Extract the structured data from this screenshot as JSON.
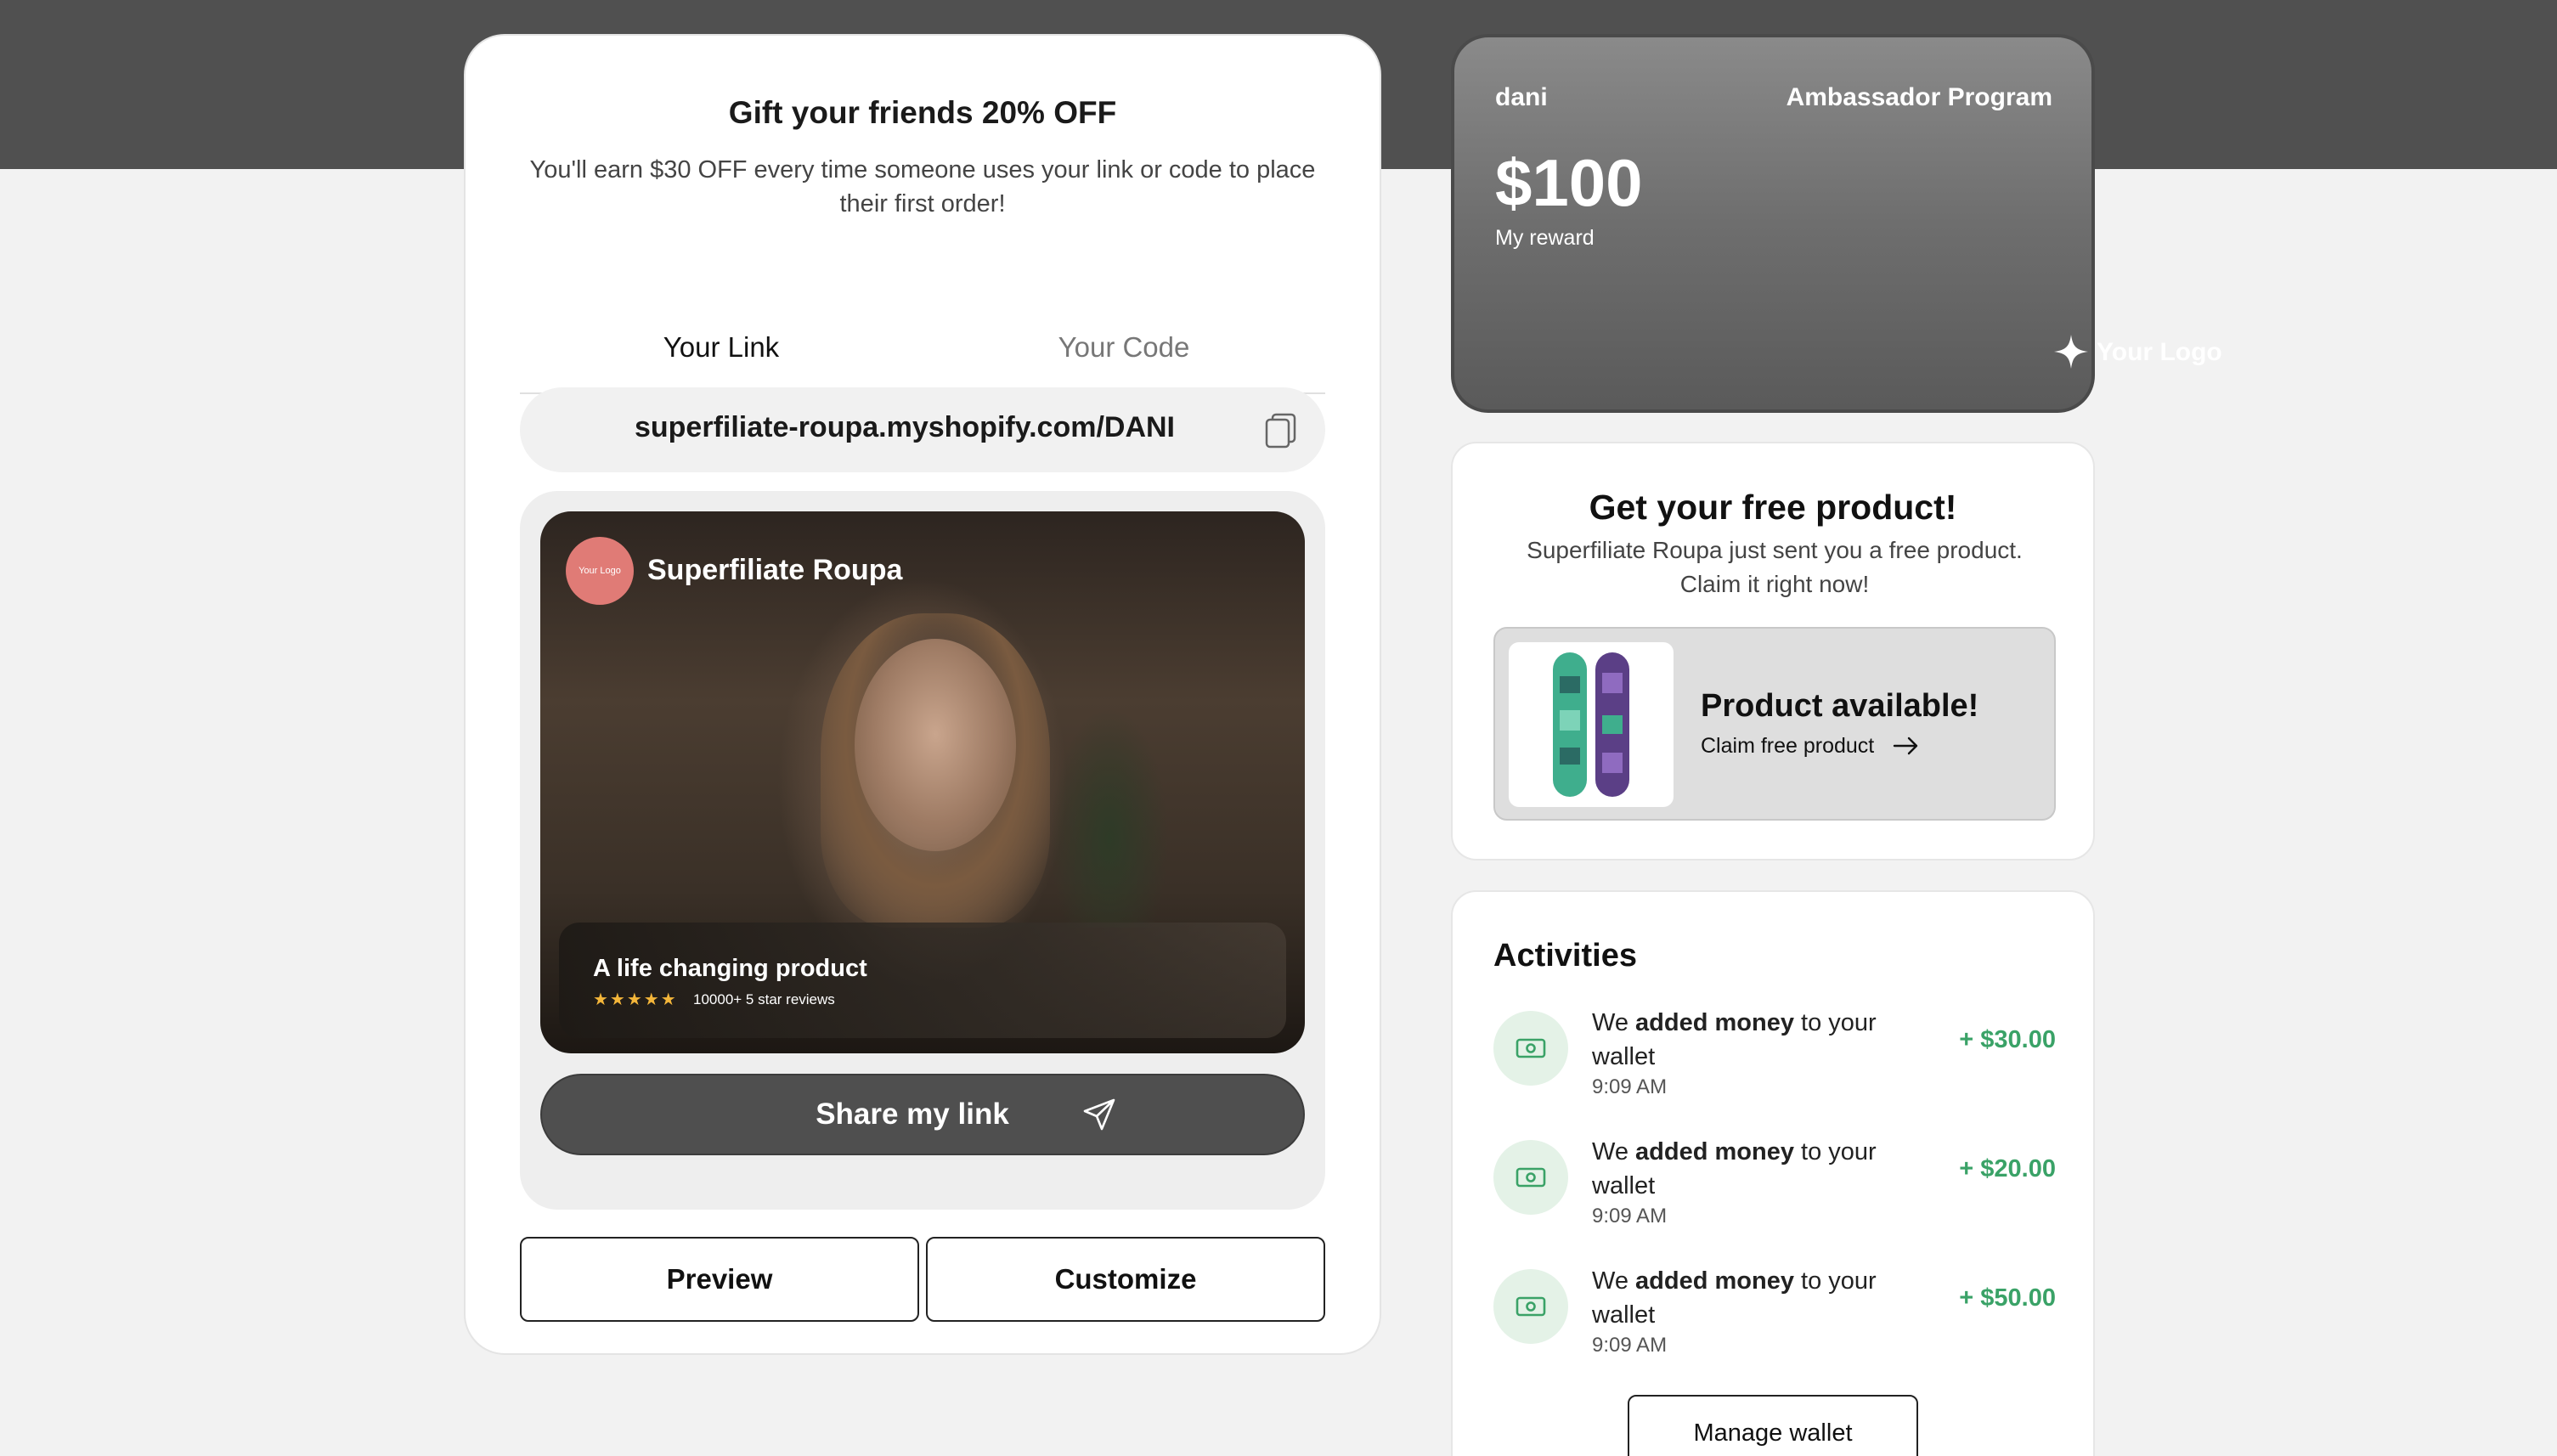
{
  "referral": {
    "title": "Gift your friends 20% OFF",
    "subtitle": "You'll earn $30 OFF every time someone uses your link or code to place their first order!",
    "tabs": {
      "link": "Your Link",
      "code": "Your Code"
    },
    "link_value": "superfiliate-roupa.myshopify.com/DANI",
    "video": {
      "logo_text": "Your Logo",
      "brand_name": "Superfiliate Roupa",
      "caption_title": "A life changing product",
      "stars": "★★★★★",
      "reviews": "10000+ 5 star reviews"
    },
    "share_label": "Share my link",
    "preview_label": "Preview",
    "customize_label": "Customize"
  },
  "reward": {
    "user": "dani",
    "program": "Ambassador Program",
    "amount": "$100",
    "label": "My reward",
    "logo_text": "Your Logo"
  },
  "free_product": {
    "title": "Get your free product!",
    "subtitle": "Superfiliate Roupa just sent you a free product. Claim it right now!",
    "available": "Product available!",
    "claim": "Claim free product"
  },
  "activities": {
    "title": "Activities",
    "items": [
      {
        "prefix": "We ",
        "bold": "added money",
        "suffix": " to your wallet",
        "time": "9:09 AM",
        "amount": "+ $30.00"
      },
      {
        "prefix": "We ",
        "bold": "added money",
        "suffix": " to your wallet",
        "time": "9:09 AM",
        "amount": "+ $20.00"
      },
      {
        "prefix": "We ",
        "bold": "added money",
        "suffix": " to your wallet",
        "time": "9:09 AM",
        "amount": "+ $50.00"
      }
    ],
    "manage_label": "Manage wallet"
  },
  "colors": {
    "header_band": "#505050",
    "accent_green": "#3aa267",
    "logo_badge": "#e07b76",
    "star_color": "#f4b63a"
  },
  "icons": {
    "copy": "copy-icon",
    "send": "send-icon",
    "arrow": "arrow-right-icon",
    "sparkle": "sparkle-icon",
    "money": "money-icon"
  }
}
